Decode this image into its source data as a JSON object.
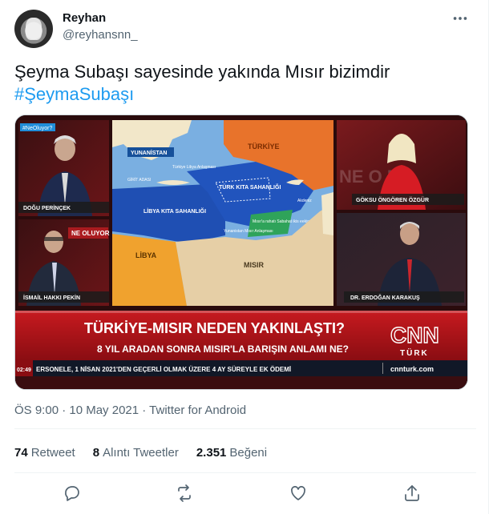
{
  "author": {
    "name": "Reyhan",
    "handle": "@reyhansnn_"
  },
  "more_icon": "more-dots-icon",
  "tweet": {
    "text": "Şeyma Subaşı  sayesinde yakında Mısır bizimdir",
    "hashtag": "#ŞeymaSubaşı"
  },
  "media": {
    "top_left_tag": "#NeOluyor?",
    "map_labels": {
      "yunanistan": "YUNANİSTAN",
      "turkiye": "TÜRKİYE",
      "turk_kita": "TÜRK KITA SAHANLIĞI",
      "libya_kita": "LİBYA KITA SAHANLIĞI",
      "libya": "LİBYA",
      "misir": "MISIR",
      "girit": "GİRİT ADASI",
      "turkiye_libya": "Türkiye Libya Anlaşması",
      "misir_rahat": "Mısır'a rahatı Sabahat ikis eekip 15 parsel",
      "yunanistan_libya": "Yunanistan Mısır Anlaşması",
      "akdeniz": "Akdeniz"
    },
    "speakers": {
      "top_left": "DOĞU PERİNÇEK",
      "bottom_left": "İSMAİL HAKKI PEKİN",
      "top_right": "GÖKSU ÖNGÖREN ÖZGÜR",
      "bottom_right": "DR. ERDOĞAN KARAKUŞ"
    },
    "ne_oluyor": "NE OLUYOR",
    "headline": "TÜRKİYE-MISIR NEDEN YAKINLAŞTI?",
    "subheadline": "8 YIL ARADAN SONRA MISIR'LA BARIŞIN ANLAMI NE?",
    "ticker_time": "02:49",
    "ticker": "ERSONELE, 1 NİSAN 2021'DEN GEÇERLİ OLMAK ÜZERE 4 AY SÜREYLE EK ÖDEMİ",
    "channel_logo": "CNN",
    "channel_logo_sub": "TÜRK",
    "channel_url": "cnnturk.com"
  },
  "meta": "ÖS 9:00 · 10 May 2021 · Twitter for Android",
  "stats": {
    "retweets_count": "74",
    "retweets_label": "Retweet",
    "quotes_count": "8",
    "quotes_label": "Alıntı Tweetler",
    "likes_count": "2.351",
    "likes_label": "Beğeni"
  },
  "actions": [
    "reply-icon",
    "retweet-icon",
    "like-icon",
    "share-icon"
  ],
  "colors": {
    "accent": "#1d9bf0",
    "secondary_text": "#536471",
    "cnn_red": "#cc0000"
  }
}
